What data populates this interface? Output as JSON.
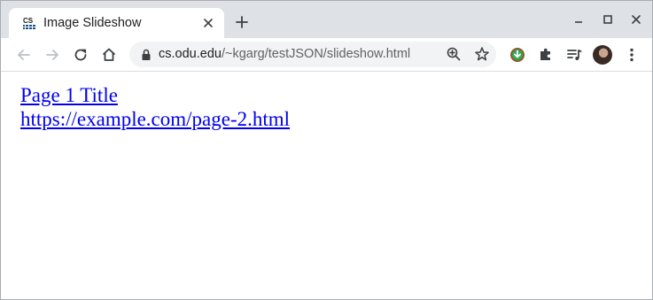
{
  "browser": {
    "tab": {
      "title": "Image Slideshow",
      "favicon": "cs-favicon-icon"
    },
    "address_bar": {
      "host": "cs.odu.edu",
      "path": "/~kgarg/testJSON/slideshow.html"
    },
    "icons": {
      "back": "arrow-left-icon",
      "forward": "arrow-right-icon",
      "reload": "reload-icon",
      "home": "home-icon",
      "lock": "lock-icon",
      "zoom": "zoom-icon",
      "bookmark": "star-icon",
      "extension": "extension-icon",
      "puzzle": "puzzle-icon",
      "media": "media-queue-icon",
      "menu": "kebab-menu-icon",
      "minimize": "minimize-icon",
      "maximize": "maximize-icon",
      "close": "close-icon",
      "new_tab": "plus-icon"
    },
    "colors": {
      "tabstrip": "#dee1e6",
      "omnibox": "#f1f3f4",
      "link": "#0000ee"
    }
  },
  "page": {
    "links": [
      {
        "text": "Page 1 Title"
      },
      {
        "text": "https://example.com/page-2.html"
      }
    ]
  }
}
